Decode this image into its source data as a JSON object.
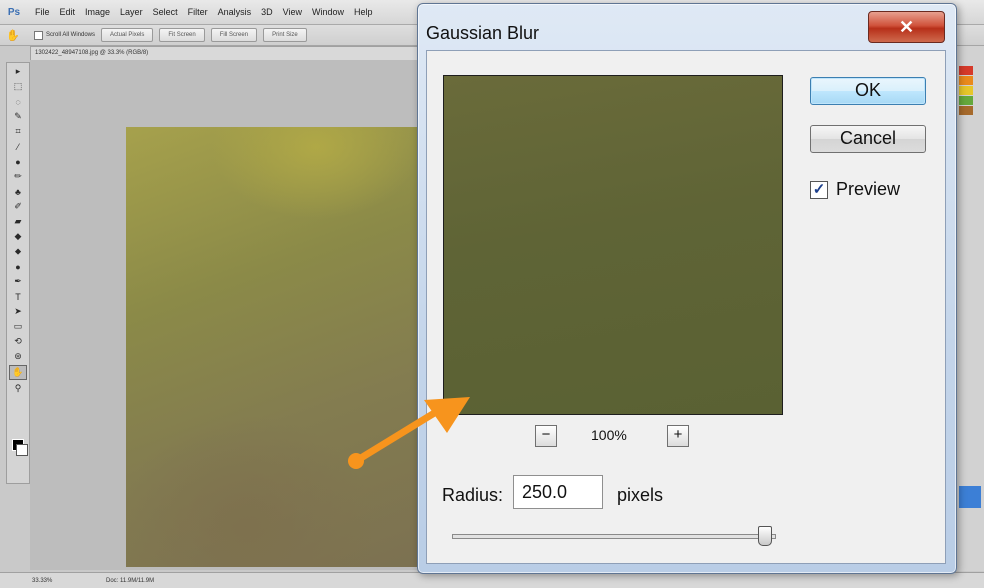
{
  "app": {
    "logo": "Ps",
    "menu": [
      "File",
      "Edit",
      "Image",
      "Layer",
      "Select",
      "Filter",
      "Analysis",
      "3D",
      "View",
      "Window",
      "Help"
    ]
  },
  "options": {
    "scroll_all_windows": "Scroll All Windows",
    "buttons": [
      "Actual Pixels",
      "Fit Screen",
      "Fill Screen",
      "Print Size"
    ]
  },
  "document": {
    "tab_title": "1302422_48947108.jpg @ 33.3% (RGB/8)"
  },
  "status": {
    "zoom": "33.33%",
    "doc_info": "Doc: 11.9M/11.9M"
  },
  "dialog": {
    "title": "Gaussian Blur",
    "ok_label": "OK",
    "cancel_label": "Cancel",
    "preview_label": "Preview",
    "preview_checked": true,
    "zoom_minus": "−",
    "zoom_plus": "+",
    "zoom_level": "100%",
    "radius_label": "Radius:",
    "radius_value": "250.0",
    "units": "pixels",
    "slider_fraction": 0.97
  },
  "colors": {
    "accent_arrow": "#f7941d",
    "preview_fill": "#5f6436"
  }
}
